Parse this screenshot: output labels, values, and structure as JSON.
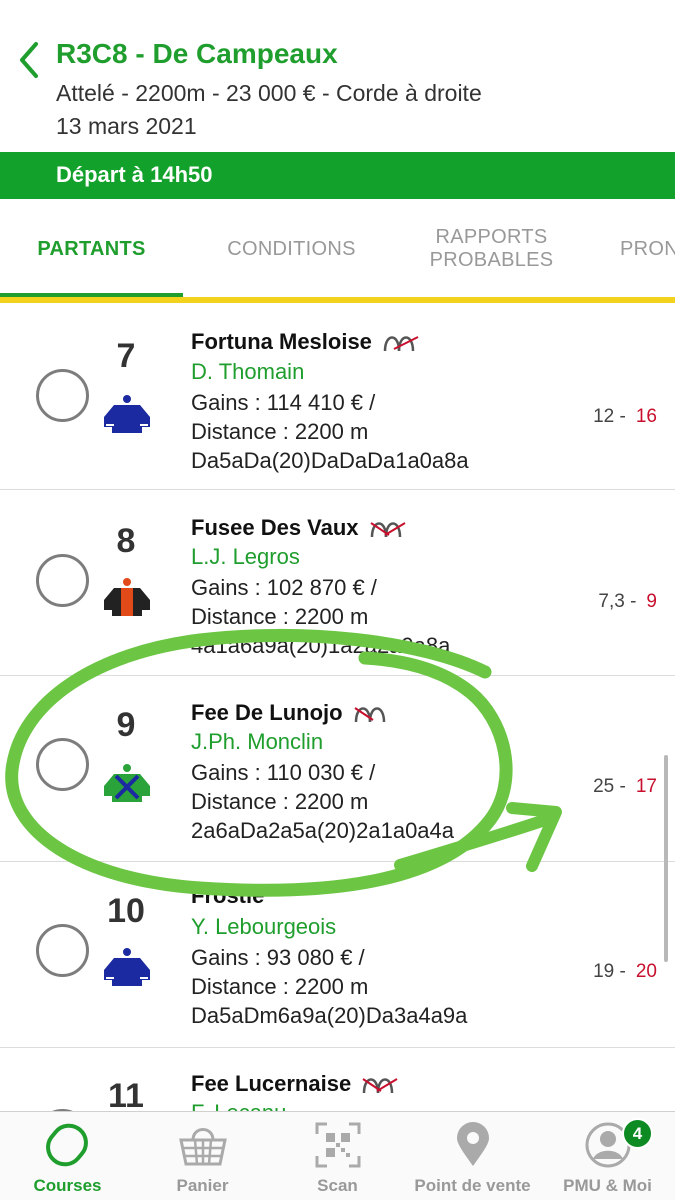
{
  "header": {
    "title": "R3C8 - De Campeaux",
    "subtitle": "Attelé - 2200m - 23 000 € - Corde à droite",
    "date": "13 mars 2021",
    "depart": "Départ à 14h50"
  },
  "tabs": {
    "partants": "PARTANTS",
    "conditions": "CONDITIONS",
    "rapports_line1": "RAPPORTS",
    "rapports_line2": "PROBABLES",
    "pronostics_partial": "PRON"
  },
  "runners": [
    {
      "num": "7",
      "name": "Fortuna Mesloise",
      "jockey": "D. Thomain",
      "gains": "Gains : 114 410 € /",
      "distance": "Distance : 2200 m",
      "musique": "Da5aDa(20)DaDaDa1a0a8a",
      "cote_ref": "12 -",
      "cote_live": "16"
    },
    {
      "num": "8",
      "name": "Fusee Des Vaux",
      "jockey": "L.J. Legros",
      "gains": "Gains : 102 870 € /",
      "distance": "Distance : 2200 m",
      "musique": "4a1a6a9a(20)1a2a2a9a8a",
      "cote_ref": "7,3 -",
      "cote_live": "9"
    },
    {
      "num": "9",
      "name": "Fee De Lunojo",
      "jockey": "J.Ph. Monclin",
      "gains": "Gains : 110 030 € /",
      "distance": "Distance : 2200 m",
      "musique": "2a6aDa2a5a(20)2a1a0a4a",
      "cote_ref": "25 -",
      "cote_live": "17"
    },
    {
      "num": "10",
      "name": "Frostie",
      "jockey": "Y. Lebourgeois",
      "gains": "Gains : 93 080 € /",
      "distance": "Distance : 2200 m",
      "musique": "Da5aDm6a9a(20)Da3a4a9a",
      "cote_ref": "19 -",
      "cote_live": "20"
    },
    {
      "num": "11",
      "name": "Fee Lucernaise",
      "jockey": "F. Lecanu",
      "gains": "",
      "distance": "",
      "musique": "",
      "cote_ref": "",
      "cote_live": ""
    }
  ],
  "bottom_nav": {
    "courses": "Courses",
    "panier": "Panier",
    "scan": "Scan",
    "point_de_vente": "Point de vente",
    "pmu_moi": "PMU & Moi",
    "badge_count": "4"
  },
  "colors": {
    "brand_green": "#1f9e2e",
    "depart_bar": "#12a12a",
    "tab_accent_yellow": "#f2d21c",
    "cote_live_red": "#c8102e",
    "annotation_green": "#6cc644"
  },
  "icons": {
    "back": "chevron-left-icon",
    "horseshoe": "horseshoe-icon",
    "courses": "courses-oval-icon",
    "panier": "basket-icon",
    "scan": "qr-code-icon",
    "point_de_vente": "map-pin-icon",
    "pmu_moi": "user-avatar-icon"
  }
}
